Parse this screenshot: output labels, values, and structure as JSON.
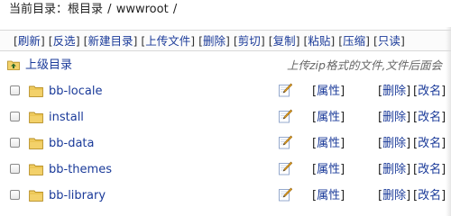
{
  "path": {
    "label": "当前目录：",
    "segments": [
      "根目录",
      "wwwroot"
    ],
    "separator": "/"
  },
  "toolbar": {
    "items": [
      "刷新",
      "反选",
      "新建目录",
      "上传文件",
      "删除",
      "剪切",
      "复制",
      "粘贴",
      "压缩",
      "只读"
    ]
  },
  "parent": {
    "label": "上级目录",
    "hint": "上传zip格式的文件,文件后面会"
  },
  "actions": {
    "attr": "属性",
    "delete": "删除",
    "rename": "改名"
  },
  "files": [
    {
      "name": "bb-locale"
    },
    {
      "name": "install"
    },
    {
      "name": "bb-data"
    },
    {
      "name": "bb-themes"
    },
    {
      "name": "bb-library"
    }
  ],
  "icons": {
    "up": "folder-up-icon",
    "folder": "folder-icon",
    "edit": "edit-icon"
  },
  "colors": {
    "link": "#1a3a99",
    "folder": "#f3c74a"
  }
}
